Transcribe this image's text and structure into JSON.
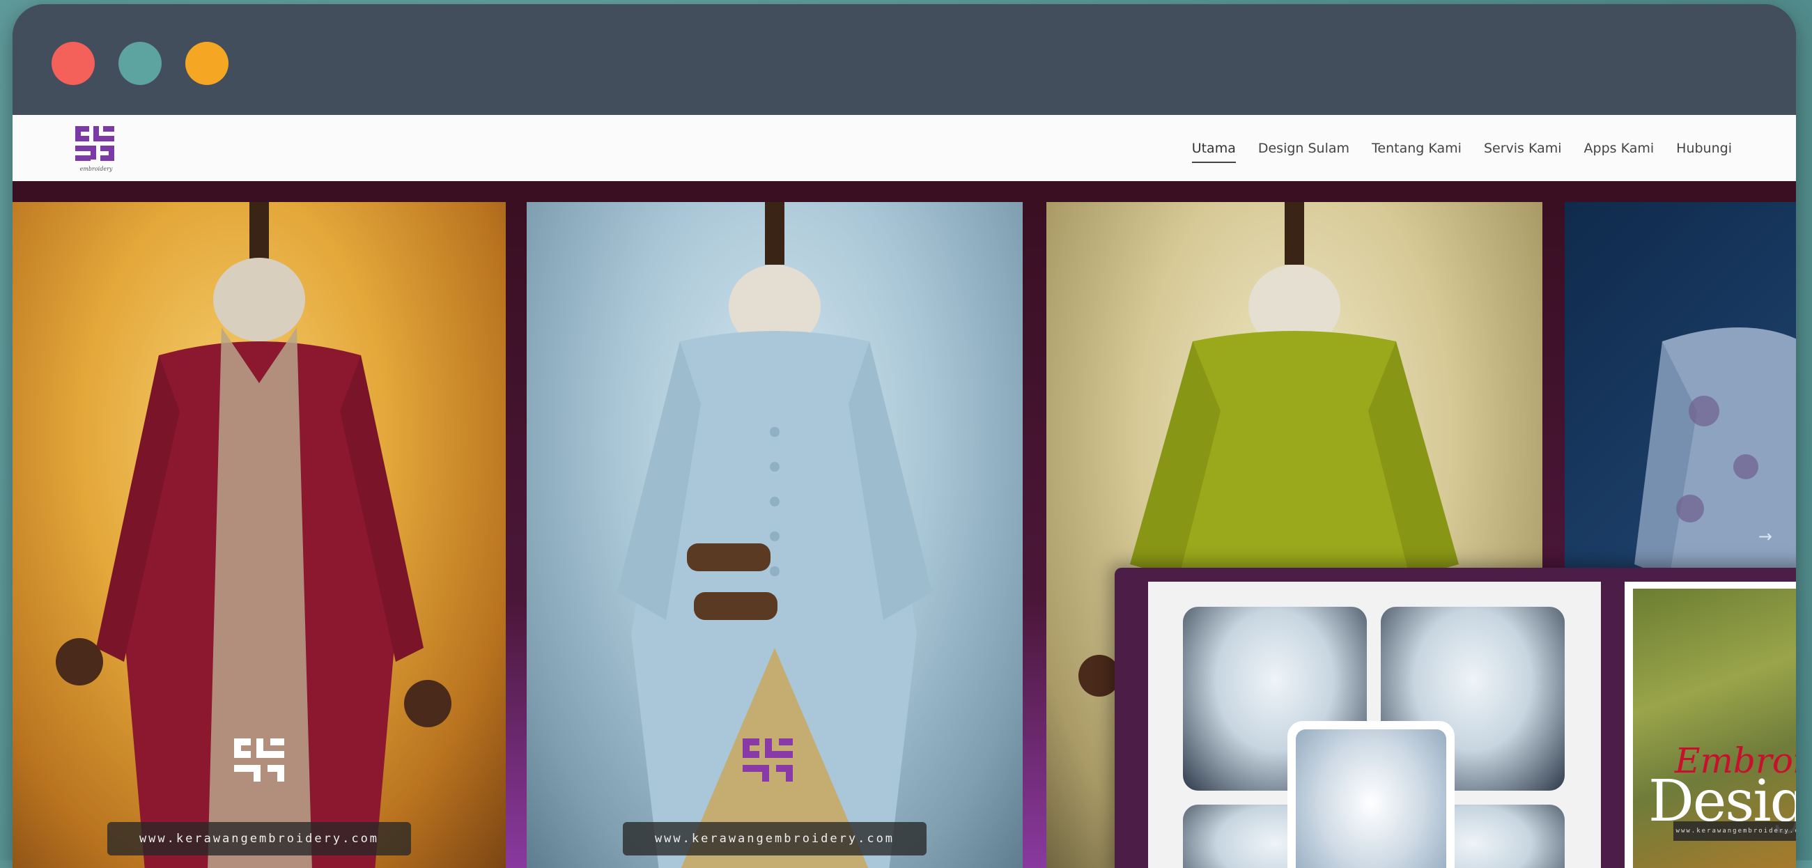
{
  "window": {
    "controls": [
      "close",
      "minimize",
      "maximize"
    ]
  },
  "brand": {
    "logo_text": "embroidery"
  },
  "nav": {
    "items": [
      {
        "label": "Utama",
        "active": true
      },
      {
        "label": "Design Sulam",
        "active": false
      },
      {
        "label": "Tentang Kami",
        "active": false
      },
      {
        "label": "Servis Kami",
        "active": false
      },
      {
        "label": "Apps Kami",
        "active": false
      },
      {
        "label": "Hubungi",
        "active": false
      }
    ]
  },
  "gallery": {
    "watermarks": [
      "www.kerawangembroidery.com",
      "www.kerawangembroidery.com"
    ],
    "next_arrow": "→"
  },
  "promo": {
    "embroide_text": "Embroide",
    "design_text": "Design",
    "mini_url": "www.kerawangembroidery.com"
  },
  "colors": {
    "titlebar": "#434e5d",
    "close": "#f4605a",
    "minimize": "#5da39f",
    "maximize": "#f5a623",
    "brand_purple": "#7b3aa6"
  }
}
